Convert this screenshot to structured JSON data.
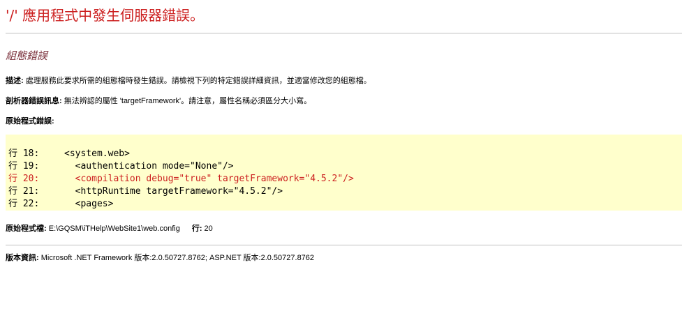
{
  "error_title": "'/' 應用程式中發生伺服器錯誤。",
  "error_subtitle": "組態錯誤",
  "description": {
    "label": "描述:",
    "text": " 處理服務此要求所需的組態檔時發生錯誤。請檢視下列的特定錯誤詳細資訊，並適當修改您的組態檔。"
  },
  "parser_error": {
    "label": "剖析器錯誤訊息:",
    "text": " 無法辨認的屬性 'targetFramework'。請注意，屬性名稱必須區分大小寫。"
  },
  "source_error_label": "原始程式錯誤:",
  "source_lines": [
    {
      "num": "行 18:",
      "code": "<system.web>",
      "error": false
    },
    {
      "num": "行 19:",
      "code": "  <authentication mode=\"None\"/>",
      "error": false
    },
    {
      "num": "行 20:",
      "code": "  <compilation debug=\"true\" targetFramework=\"4.5.2\"/>",
      "error": true
    },
    {
      "num": "行 21:",
      "code": "  <httpRuntime targetFramework=\"4.5.2\"/>",
      "error": false
    },
    {
      "num": "行 22:",
      "code": "  <pages>",
      "error": false
    }
  ],
  "source_file": {
    "label": "原始程式檔:",
    "path": " E:\\GQSM\\iTHelp\\WebSite1\\web.config",
    "line_label": "行:",
    "line_value": " 20"
  },
  "version_info": {
    "label": "版本資訊:",
    "text": " Microsoft .NET Framework 版本:2.0.50727.8762; ASP.NET 版本:2.0.50727.8762"
  },
  "colors": {
    "title": "#cc1f1f",
    "subtitle": "#7a2f3a",
    "code_background": "#ffffcc",
    "error_line": "#cc1f1f"
  }
}
